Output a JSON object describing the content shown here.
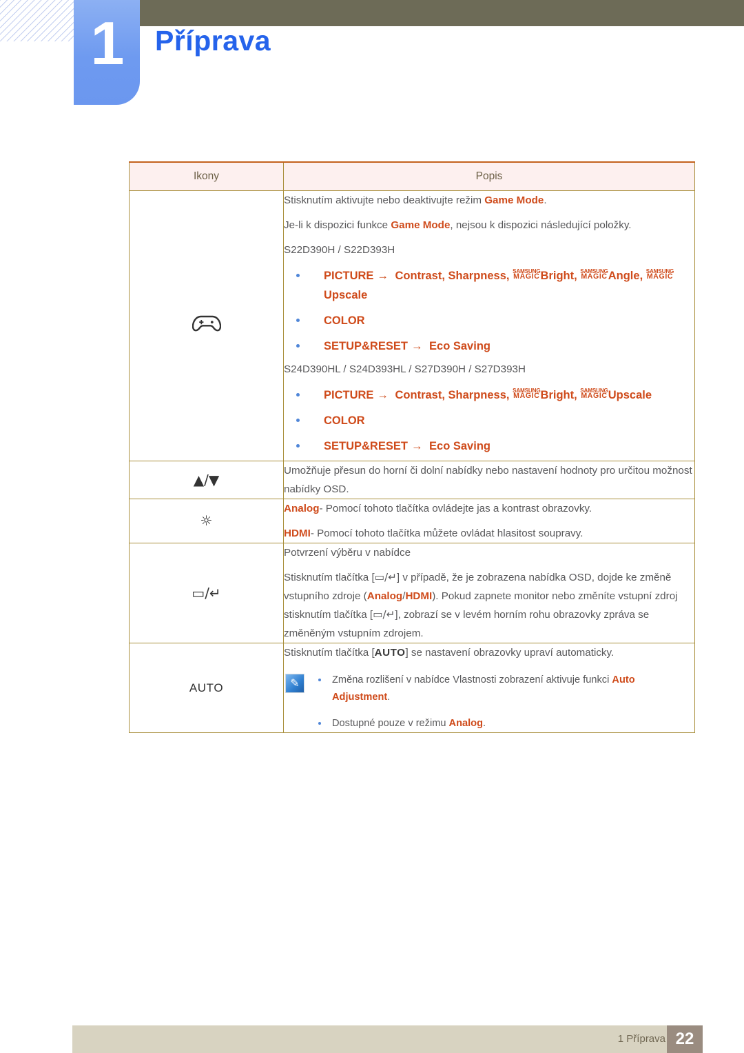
{
  "header": {
    "chapter_number": "1",
    "chapter_title": "Příprava"
  },
  "table": {
    "columns": [
      "Ikony",
      "Popis"
    ],
    "rows": [
      {
        "icon_name": "gamepad-icon",
        "icon_glyph": "",
        "lines": [
          "Stisknutím aktivujte nebo deaktivujte režim ",
          "Je-li k dispozici funkce ",
          ", nejsou k dispozici následující položky.",
          "S22D390H / S22D393H",
          "S24D390HL / S24D393HL / S27D390H / S27D393H"
        ],
        "game_mode": "Game Mode",
        "group1_models": "S22D390H / S22D393H",
        "group2_models": "S24D390HL / S24D393HL / S27D390H / S27D393H",
        "group1_paths": [
          {
            "menu": "PICTURE",
            "items": "Contrast, Sharpness, MAGICBright, MAGICAngle, MAGICUpscale"
          },
          {
            "menu": "COLOR",
            "items": ""
          },
          {
            "menu": "SETUP&RESET",
            "items": "Eco Saving"
          }
        ],
        "group2_paths": [
          {
            "menu": "PICTURE",
            "items": "Contrast, Sharpness, MAGICBright, MAGICUpscale"
          },
          {
            "menu": "COLOR",
            "items": ""
          },
          {
            "menu": "SETUP&RESET",
            "items": "Eco Saving"
          }
        ],
        "magic_sup": "SAMSUNG",
        "magic_sub": "MAGIC",
        "token_contrast": "Contrast",
        "token_sharpness": "Sharpness",
        "token_bright": "Bright",
        "token_angle": "Angle",
        "token_upscale": "Upscale",
        "token_color": "COLOR",
        "token_picture": "PICTURE",
        "token_setupreset": "SETUP&RESET",
        "token_ecosaving": "Eco Saving",
        "arrow": "→"
      },
      {
        "icon_name": "up-down-arrows-icon",
        "icon_glyph": "▲/▼",
        "text": "Umožňuje přesun do horní či dolní nabídky nebo nastavení hodnoty pro určitou možnost nabídky OSD."
      },
      {
        "icon_name": "brightness-icon",
        "icon_glyph": "☼",
        "analog_label": "Analog",
        "analog_text": "- Pomocí tohoto tlačítka ovládejte jas a kontrast obrazovky.",
        "hdmi_label": "HDMI",
        "hdmi_text": "- Pomocí tohoto tlačítka můžete ovládat hlasitost soupravy."
      },
      {
        "icon_name": "menu-enter-icon",
        "icon_glyph": "▭/↵",
        "line1": "Potvrzení výběru v nabídce",
        "line2_a": "Stisknutím tlačítka [",
        "line2_b": "] v případě, že je zobrazena nabídka OSD, dojde ke změně vstupního zdroje (",
        "analog_label": "Analog",
        "slash": "/",
        "hdmi_label": "HDMI",
        "line2_c": "). Pokud zapnete monitor nebo změníte vstupní zdroj stisknutím tlačítka [",
        "line2_d": "], zobrazí se v levém horním rohu obrazovky zpráva se změněným vstupním zdrojem."
      },
      {
        "icon_name": "auto-button-icon",
        "icon_glyph": "AUTO",
        "line1_a": "Stisknutím tlačítka [",
        "auto_key": "AUTO",
        "line1_b": "] se nastavení obrazovky upraví automaticky.",
        "note_icon": "note-pencil-icon",
        "notes": [
          {
            "text_a": "Změna rozlišení v nabídce Vlastnosti zobrazení aktivuje funkci ",
            "highlight": "Auto Adjustment",
            "text_b": "."
          },
          {
            "text_a": "Dostupné pouze v režimu ",
            "highlight": "Analog",
            "text_b": "."
          }
        ]
      }
    ]
  },
  "footer": {
    "chapter_ref": "1 Příprava",
    "page_number": "22"
  },
  "colors": {
    "accent_orange": "#cf4b1b",
    "chapter_blue": "#2563eb",
    "badge_blue": "#6e9af0",
    "olive_bar": "#6d6b57",
    "footer_bar": "#d8d3c1",
    "page_box": "#9a8c80",
    "table_border": "#a98f3c",
    "header_bg": "#fdf0ef"
  }
}
